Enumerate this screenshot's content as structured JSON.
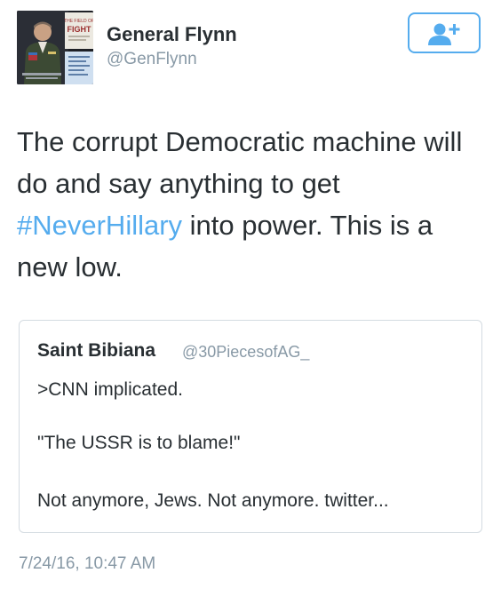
{
  "author": {
    "display_name": "General Flynn",
    "handle": "@GenFlynn",
    "avatar_book_word": "FIGHT"
  },
  "follow_button": {
    "icon": "add-user-icon"
  },
  "tweet": {
    "text_before": "The corrupt Democratic machine will do and say anything to get ",
    "hashtag": "#NeverHillary",
    "text_after": " into power. This is a new low."
  },
  "quoted_tweet": {
    "display_name": "Saint Bibiana",
    "handle": "@30PiecesofAG_",
    "lines": [
      ">CNN implicated.",
      "\"The USSR is to blame!\"",
      "Not anymore, Jews. Not anymore. twitter..."
    ]
  },
  "timestamp": "7/24/16, 10:47 AM",
  "colors": {
    "link": "#55acee",
    "text": "#292f33",
    "secondary": "#8899a6",
    "border": "#d4dbe1"
  }
}
